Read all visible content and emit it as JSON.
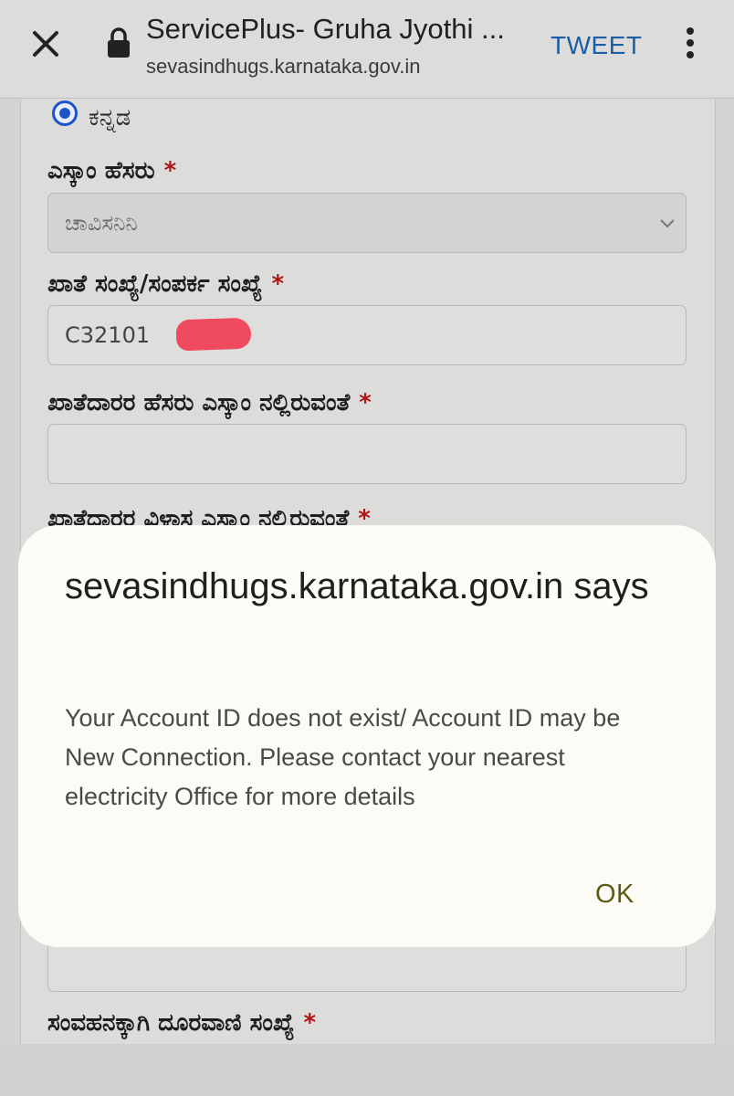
{
  "browser": {
    "title": "ServicePlus- Gruha Jyothi ...",
    "url": "sevasindhugs.karnataka.gov.in",
    "tweet_label": "TWEET"
  },
  "form": {
    "language_option": "ಕನ್ನಡ",
    "escom_label": "ಎಸ್ಕಾಂ ಹೆಸರು",
    "escom_value": "ಚಾವಿಸನಿನಿ",
    "account_label": "ಖಾತೆ ಸಂಖ್ಯೆ/ಸಂಪರ್ಕ ಸಂಖ್ಯೆ",
    "account_value": "C32101",
    "holder_name_label": "ಖಾತೆದಾರರ ಹೆಸರು ಎಸ್ಕಾಂ ನಲ್ಲಿರುವಂತೆ",
    "holder_address_label": "ಖಾತೆದಾರರ ವಿಳಾಸ ಎಸ್ಕಾಂ ನಲ್ಲಿರುವಂತೆ",
    "phone_label": "ಸಂವಹನಕ್ಕಾಗಿ ದೂರವಾಣಿ ಸಂಖ್ಯೆ",
    "required_mark": "*"
  },
  "dialog": {
    "title": "sevasindhugs.karnataka.gov.in says",
    "message": "Your Account ID does not exist/ Account ID may be New Connection. Please contact your nearest electricity Office for more details",
    "ok_label": "OK"
  },
  "colors": {
    "accent": "#1a5fa5",
    "radio": "#1d55c9",
    "required": "#b01616",
    "redaction": "#ef4a5e"
  }
}
